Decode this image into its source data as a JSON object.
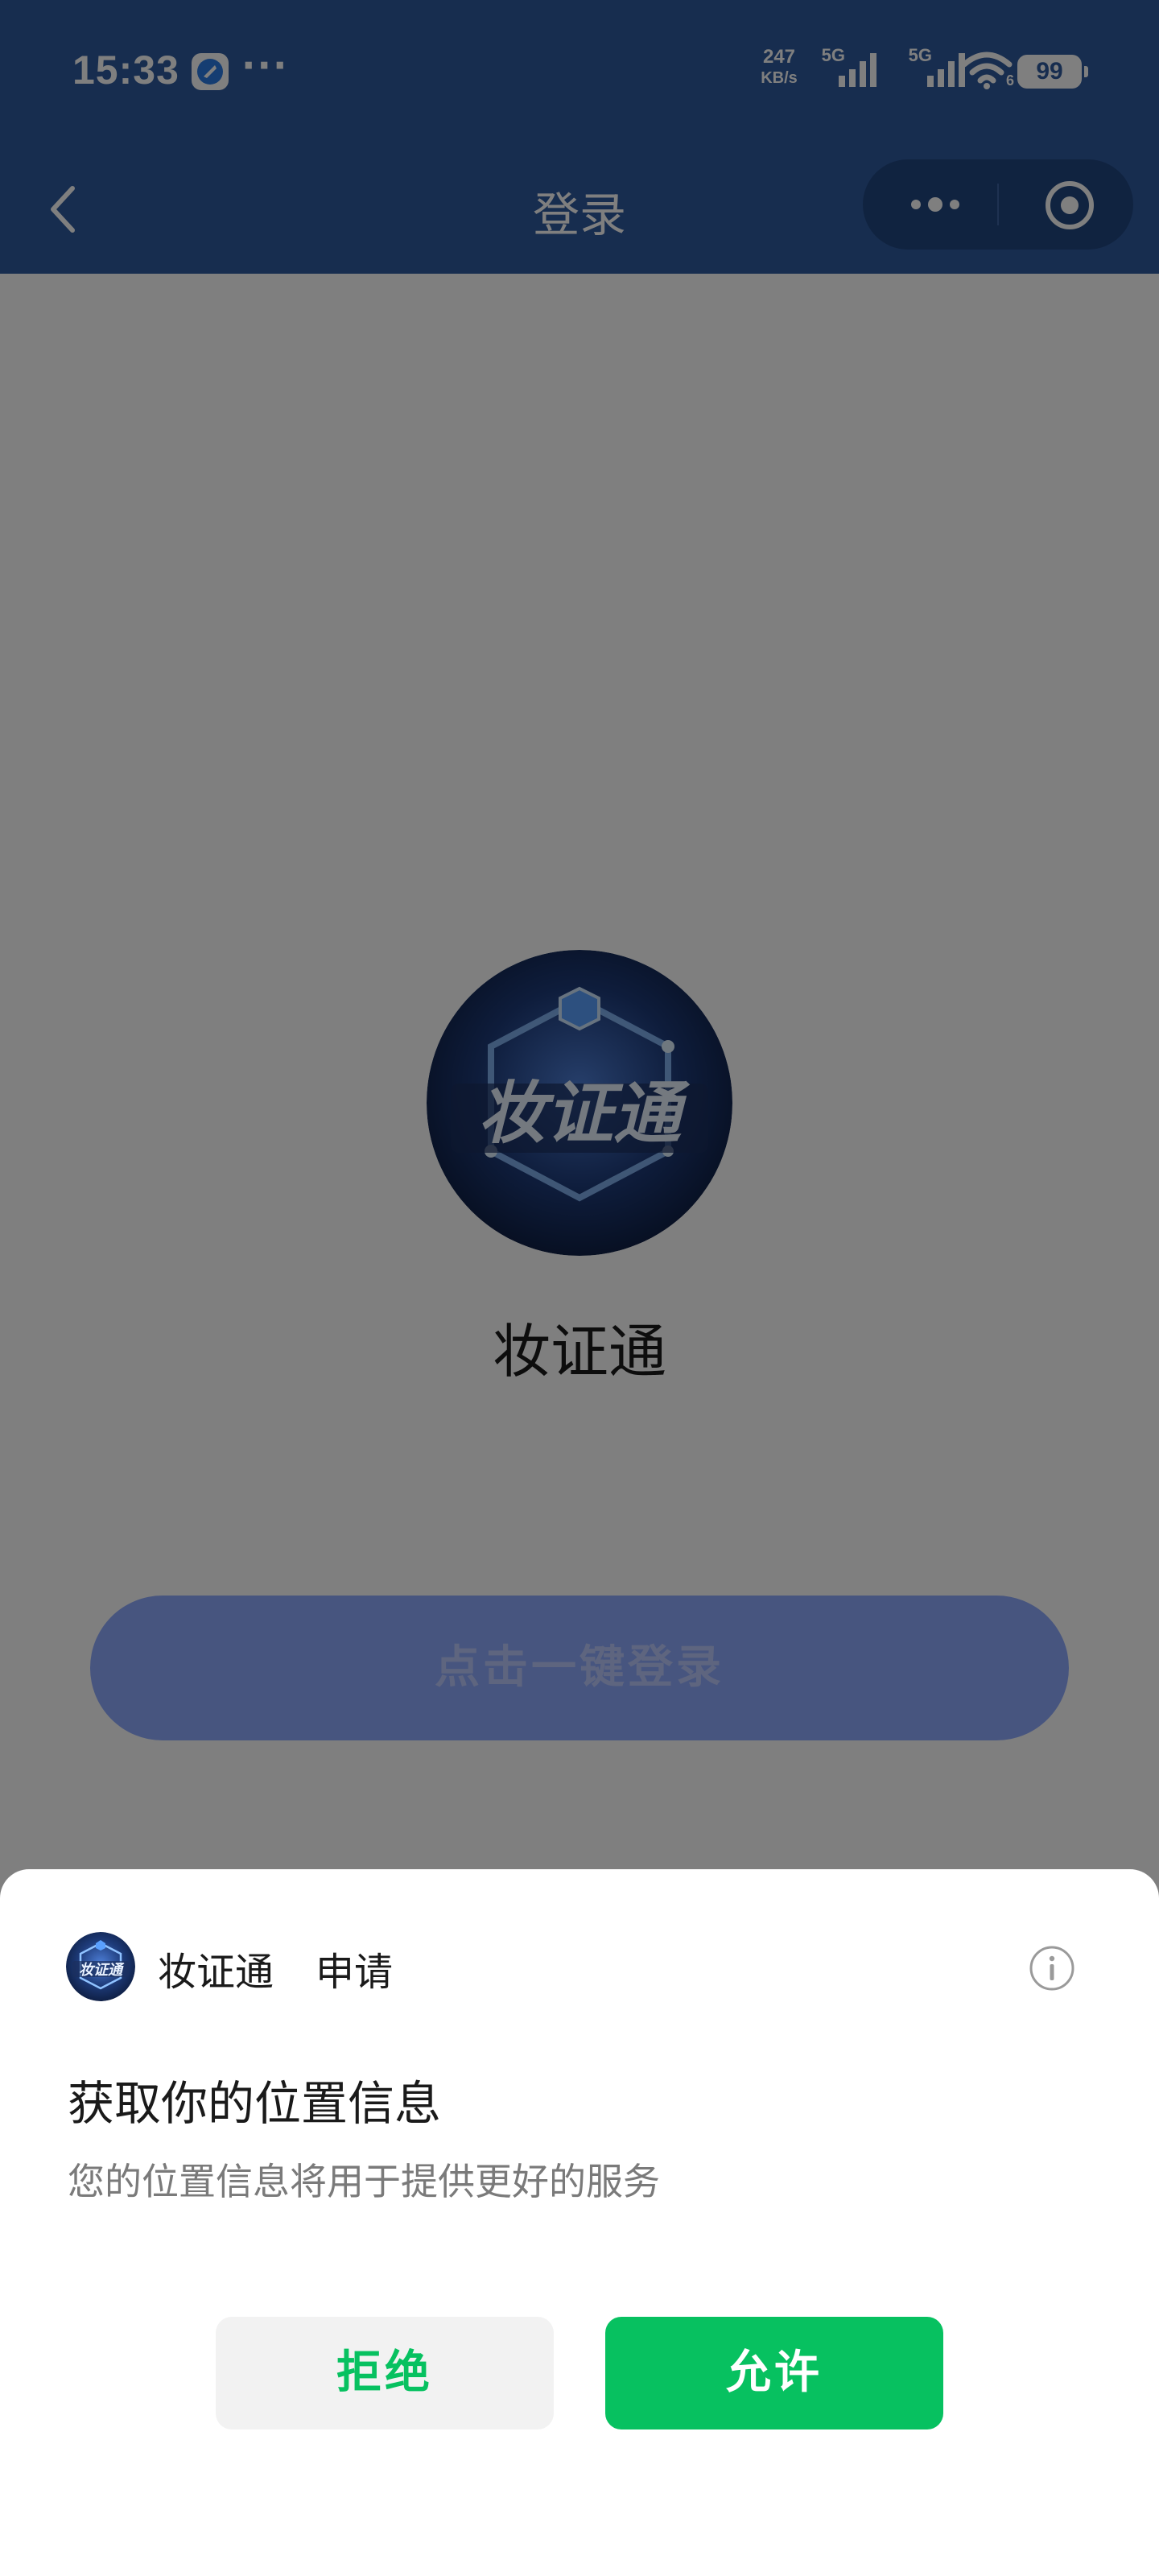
{
  "status_bar": {
    "time": "15:33",
    "more": "···",
    "net_speed_value": "247",
    "net_speed_unit": "KB/s",
    "sim1_label": "5G",
    "sim2_label": "5G",
    "wifi_badge": "6",
    "battery": "99"
  },
  "nav": {
    "title": "登录"
  },
  "page": {
    "app_name": "妆证通",
    "login_button": "点击一键登录"
  },
  "permission_sheet": {
    "app_name": "妆证通",
    "request_word": "申请",
    "title": "获取你的位置信息",
    "description": "您的位置信息将用于提供更好的服务",
    "deny_label": "拒绝",
    "allow_label": "允许"
  },
  "colors": {
    "header": "#2f5a9e",
    "login_button": "#8eaaff",
    "allow_green": "#07c160"
  },
  "logo_text": "妆证通"
}
